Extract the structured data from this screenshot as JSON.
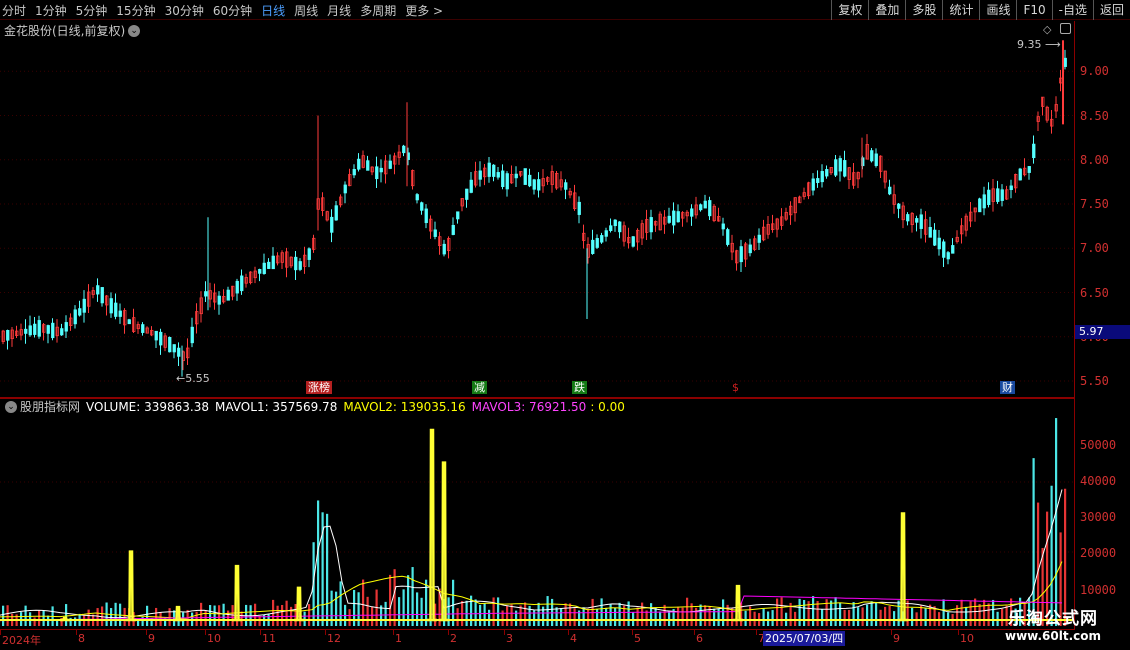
{
  "toolbar": {
    "periods": [
      "分时",
      "1分钟",
      "5分钟",
      "15分钟",
      "30分钟",
      "60分钟",
      "日线",
      "周线",
      "月线",
      "多周期",
      "更多 >"
    ],
    "active_period": "日线",
    "actions": [
      "复权",
      "叠加",
      "多股",
      "统计",
      "画线",
      "F10",
      "-自选",
      "返回"
    ]
  },
  "main_panel": {
    "title": "金花股份(日线,前复权)",
    "high_label": "9.35",
    "low_label": "5.55",
    "current_price": "5.97",
    "price_axis": [
      "9.00",
      "8.50",
      "8.00",
      "7.50",
      "7.00",
      "6.50",
      "6.00",
      "5.50"
    ],
    "events": [
      {
        "label": "涨榜",
        "color": "#b52020"
      },
      {
        "label": "减",
        "color": "#157a15"
      },
      {
        "label": "跌",
        "color": "#157a15"
      },
      {
        "label": "$",
        "color": "#d02020"
      },
      {
        "label": "财",
        "color": "#1a4aa0"
      }
    ]
  },
  "volume_panel": {
    "indicator_name": "股朋指标网",
    "volume_label": "VOLUME: 339863.38",
    "mavol1_label": "MAVOL1: 357569.78",
    "mavol2_label": "MAVOL2: 139035.16",
    "mavol3_label": "MAVOL3: 76921.50",
    "extra_label": ": 0.00",
    "volume_axis": [
      "50000",
      "40000",
      "30000",
      "20000",
      "10000"
    ],
    "colors": {
      "mavol1": "#ffffff",
      "mavol2": "#ffff00",
      "mavol3": "#ff00ff",
      "spikes": "#ffff33"
    }
  },
  "date_axis": {
    "ticks": [
      "2024年",
      "8",
      "9",
      "10",
      "11",
      "12",
      "1",
      "2",
      "3",
      "4",
      "5",
      "6",
      "7",
      "9",
      "10"
    ],
    "cursor": "2025/07/03/四"
  },
  "watermark": {
    "line1": "乐淘公式网",
    "line2": "www.60lt.com"
  },
  "chart_data": {
    "type": "candlestick",
    "title": "金花股份(日线,前复权)",
    "y_axis_ticks": [
      5.5,
      6.0,
      6.5,
      7.0,
      7.5,
      8.0,
      8.5,
      9.0
    ],
    "ylim": [
      5.3,
      9.45
    ],
    "high": 9.35,
    "low": 5.55,
    "last_price": 5.97,
    "trend": [
      [
        0,
        6.0
      ],
      [
        20,
        6.05
      ],
      [
        40,
        6.1
      ],
      [
        60,
        6.05
      ],
      [
        80,
        6.3
      ],
      [
        95,
        6.55
      ],
      [
        110,
        6.35
      ],
      [
        130,
        6.15
      ],
      [
        150,
        6.05
      ],
      [
        170,
        5.9
      ],
      [
        185,
        5.75
      ],
      [
        195,
        6.2
      ],
      [
        205,
        6.5
      ],
      [
        220,
        6.4
      ],
      [
        240,
        6.6
      ],
      [
        260,
        6.75
      ],
      [
        280,
        6.9
      ],
      [
        300,
        6.8
      ],
      [
        312,
        7.0
      ],
      [
        318,
        7.6
      ],
      [
        330,
        7.25
      ],
      [
        345,
        7.7
      ],
      [
        360,
        8.0
      ],
      [
        375,
        7.85
      ],
      [
        390,
        7.95
      ],
      [
        405,
        8.15
      ],
      [
        415,
        7.6
      ],
      [
        430,
        7.25
      ],
      [
        445,
        6.95
      ],
      [
        460,
        7.5
      ],
      [
        475,
        7.8
      ],
      [
        490,
        7.9
      ],
      [
        505,
        7.75
      ],
      [
        520,
        7.85
      ],
      [
        535,
        7.7
      ],
      [
        550,
        7.8
      ],
      [
        565,
        7.7
      ],
      [
        578,
        7.45
      ],
      [
        585,
        6.95
      ],
      [
        600,
        7.1
      ],
      [
        615,
        7.3
      ],
      [
        630,
        7.05
      ],
      [
        645,
        7.25
      ],
      [
        660,
        7.3
      ],
      [
        675,
        7.35
      ],
      [
        690,
        7.4
      ],
      [
        705,
        7.5
      ],
      [
        720,
        7.3
      ],
      [
        735,
        6.9
      ],
      [
        750,
        7.0
      ],
      [
        765,
        7.2
      ],
      [
        780,
        7.3
      ],
      [
        795,
        7.5
      ],
      [
        810,
        7.7
      ],
      [
        825,
        7.85
      ],
      [
        840,
        7.95
      ],
      [
        855,
        7.75
      ],
      [
        865,
        8.1
      ],
      [
        880,
        7.95
      ],
      [
        890,
        7.6
      ],
      [
        905,
        7.35
      ],
      [
        920,
        7.3
      ],
      [
        935,
        7.1
      ],
      [
        948,
        6.9
      ],
      [
        960,
        7.2
      ],
      [
        975,
        7.45
      ],
      [
        990,
        7.6
      ],
      [
        1005,
        7.6
      ],
      [
        1020,
        7.85
      ],
      [
        1030,
        7.9
      ],
      [
        1040,
        8.7
      ],
      [
        1050,
        8.4
      ],
      [
        1058,
        8.7
      ],
      [
        1063,
        9.35
      ],
      [
        1066,
        8.6
      ]
    ],
    "volume_spikes": [
      [
        65,
        2200
      ],
      [
        131,
        20500
      ],
      [
        178,
        5200
      ],
      [
        237,
        16500
      ],
      [
        299,
        10500
      ],
      [
        432,
        54000
      ],
      [
        444,
        45000
      ],
      [
        738,
        11000
      ],
      [
        903,
        31000
      ]
    ]
  }
}
